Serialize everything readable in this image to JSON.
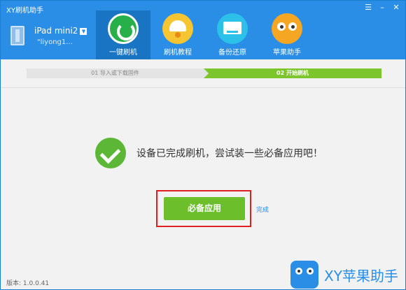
{
  "app": {
    "title": "XY刷机助手"
  },
  "window_controls": [
    {
      "icon": "menu-icon",
      "glyph": "☰"
    },
    {
      "icon": "minimize-icon",
      "glyph": "–"
    },
    {
      "icon": "close-icon",
      "glyph": "✕"
    }
  ],
  "device": {
    "name": "iPad mini2",
    "account": "\"liyong1..."
  },
  "nav": [
    {
      "label": "一键刷机",
      "icon": "refresh-icon",
      "active": true
    },
    {
      "label": "刷机教程",
      "icon": "lamp-icon",
      "active": false
    },
    {
      "label": "备份还原",
      "icon": "backup-icon",
      "active": false
    },
    {
      "label": "苹果助手",
      "icon": "owl-icon",
      "active": false
    }
  ],
  "steps": {
    "step1": "01 导入或下载固件",
    "step2": "02 开始刷机"
  },
  "message": "设备已完成刷机，尝试装一些必备应用吧！",
  "install_button": "必备应用",
  "done_link": "完成",
  "version": "版本: 1.0.0.41",
  "brand": "XY苹果助手"
}
